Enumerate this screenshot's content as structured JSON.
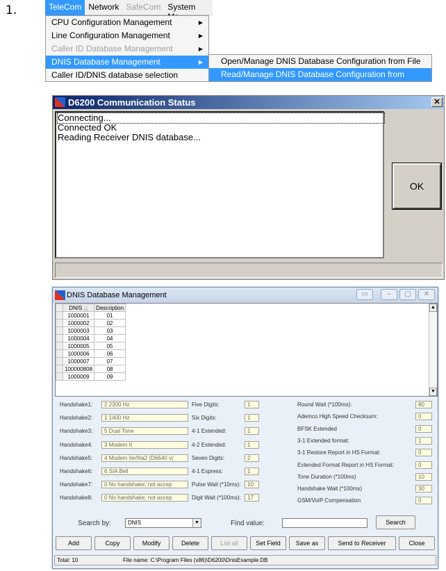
{
  "step_number": "1.",
  "menubar": {
    "items": [
      "TeleCom",
      "Network",
      "SafeCom",
      "System Ma"
    ]
  },
  "telecom_menu": {
    "items": [
      {
        "label": "CPU Configuration Management",
        "submenu": true,
        "disabled": false
      },
      {
        "label": "Line Configuration Management",
        "submenu": true,
        "disabled": false
      },
      {
        "label": "Caller ID Database Management",
        "submenu": true,
        "disabled": true
      },
      {
        "label": "DNIS Database Management",
        "submenu": true,
        "disabled": false,
        "highlighted": true
      },
      {
        "label": "Caller ID/DNIS database selection",
        "submenu": false,
        "disabled": false
      }
    ]
  },
  "dnis_submenu": {
    "items": [
      "Open/Manage DNIS Database Configuration from File",
      "Read/Manage DNIS Database Configuration from Receiver"
    ]
  },
  "comm_dialog": {
    "title": "D6200 Communication Status",
    "close": "✕",
    "log_lines": [
      "Connecting...",
      "Connected OK",
      "Reading Receiver DNIS database..."
    ],
    "ok_label": "OK"
  },
  "dnis_dialog": {
    "title": "DNIS Database Management",
    "columns": [
      "DNIS",
      "Description"
    ],
    "rows": [
      [
        "1000001",
        "01"
      ],
      [
        "1000002",
        "02"
      ],
      [
        "1000003",
        "03"
      ],
      [
        "1000004",
        "04"
      ],
      [
        "1000005",
        "05"
      ],
      [
        "1000006",
        "06"
      ],
      [
        "1000007",
        "07"
      ],
      [
        "100000808",
        "08"
      ],
      [
        "1000009",
        "09"
      ]
    ],
    "handshakes": [
      {
        "label": "Handshake1:",
        "value": "2  2300 Hz"
      },
      {
        "label": "Handshake2:",
        "value": "1  1400 Hz"
      },
      {
        "label": "Handshake3:",
        "value": "5  Dual Tone"
      },
      {
        "label": "Handshake4:",
        "value": "3  Modem II"
      },
      {
        "label": "Handshake5:",
        "value": "4  Modem IIe/IIIa2 (D6640 v("
      },
      {
        "label": "Handshake6:",
        "value": "6  SIA Bell"
      },
      {
        "label": "Handshake7:",
        "value": "0  No handshake, not accep"
      },
      {
        "label": "Handshake8:",
        "value": "0  No handshake, not accep"
      }
    ],
    "mid_fields": [
      {
        "label": "Five Digits:",
        "value": "1"
      },
      {
        "label": "Six Digits:",
        "value": "1"
      },
      {
        "label": "4-1 Extended:",
        "value": "1"
      },
      {
        "label": "4-2 Extended:",
        "value": "1"
      },
      {
        "label": "Seven Digits:",
        "value": "2"
      },
      {
        "label": "4-1 Express:",
        "value": "1"
      },
      {
        "label": "Pulse Wait (*10ms):",
        "value": "10"
      },
      {
        "label": "Digit Wait (*100ms):",
        "value": "17"
      }
    ],
    "right_fields": [
      {
        "label": "Round Wait (*100ms):",
        "value": "80"
      },
      {
        "label": "Ademco High Speed Checksum:",
        "value": "0"
      },
      {
        "label": "BFSK Extended",
        "value": "0"
      },
      {
        "label": "3-1 Extended format:",
        "value": "1"
      },
      {
        "label": "3-1 Restore Report in HS Format:",
        "value": "0"
      },
      {
        "label": "Extended Format Report in HS Format:",
        "value": "0"
      },
      {
        "label": "Tone Duration (*100ms)",
        "value": "10"
      },
      {
        "label": "Handshake Wait (*100ms)",
        "value": "30"
      },
      {
        "label": "GSM/VoIP Compensation",
        "value": "0"
      }
    ],
    "search_by_label": "Search by:",
    "search_by_value": "DNIS",
    "find_value_label": "Find value:",
    "search_button": "Search",
    "buttons": [
      "Add",
      "Copy",
      "Modify",
      "Delete",
      "List all",
      "Set Field",
      "Save as",
      "Send to Receiver",
      "Close"
    ],
    "status_total": "Total: 10",
    "status_file": "File name: C:\\Program Files (x86)\\D6200\\DnisExample.DB"
  }
}
